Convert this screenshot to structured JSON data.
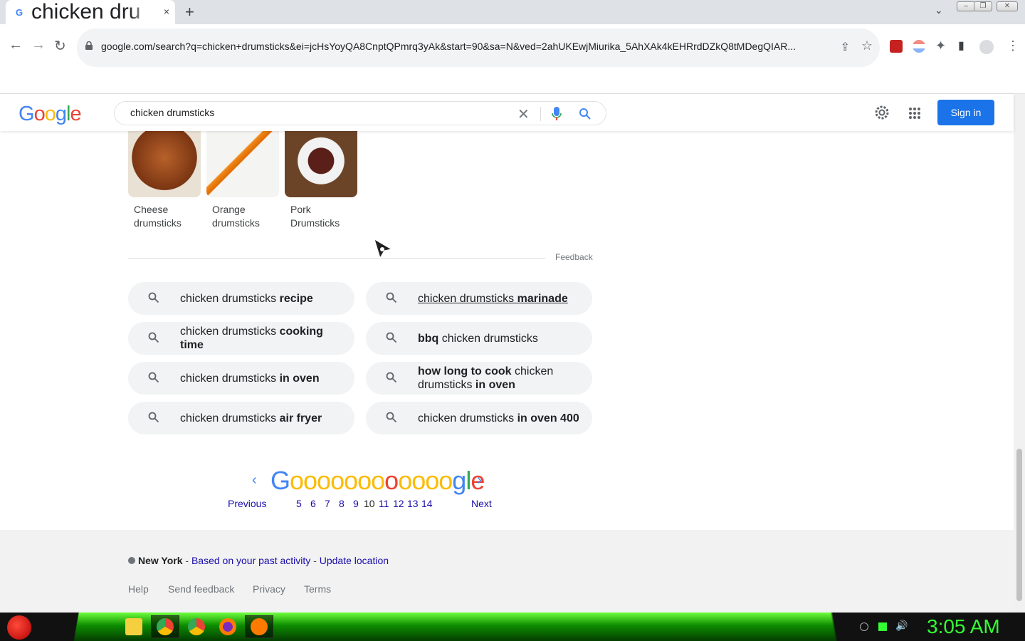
{
  "browser": {
    "tab_title": "chicken dru",
    "tab_favicon": "G",
    "close_tab": "×",
    "new_tab": "+",
    "url": "google.com/search?q=chicken+drumsticks&ei=jcHsYoyQA8CnptQPmrq3yAk&start=90&sa=N&ved=2ahUKEwjMiurika_5AhXAk4kEHRrdDZkQ8tMDegQIAR...",
    "icons": [
      "back-icon",
      "forward-icon",
      "reload-icon",
      "lock-icon",
      "share-icon",
      "star-icon",
      "extension-icon",
      "profile-icon",
      "menu-icon"
    ]
  },
  "header": {
    "logo": "Google",
    "search_query": "chicken drumsticks",
    "sign_in": "Sign in"
  },
  "related_images": [
    {
      "label": "Cheese drumsticks"
    },
    {
      "label": "Orange drumsticks"
    },
    {
      "label": "Pork Drumsticks"
    }
  ],
  "feedback": "Feedback",
  "related_searches": [
    {
      "pre": "chicken drumsticks ",
      "bold": "recipe",
      "post": ""
    },
    {
      "pre": "chicken drumsticks ",
      "bold": "marinade",
      "post": ""
    },
    {
      "pre": "chicken drumsticks ",
      "bold": "cooking time",
      "post": ""
    },
    {
      "pre": "",
      "bold": "bbq",
      "post": " chicken drumsticks"
    },
    {
      "pre": "chicken drumsticks ",
      "bold": "in oven",
      "post": ""
    },
    {
      "pre": "",
      "bold": "how long to cook",
      "post": " chicken drumsticks ",
      "bold2": "in oven"
    },
    {
      "pre": "chicken drumsticks ",
      "bold": "air fryer",
      "post": ""
    },
    {
      "pre": "chicken drumsticks ",
      "bold": "in oven 400",
      "post": ""
    }
  ],
  "pagination": {
    "previous": "Previous",
    "next": "Next",
    "pages": [
      "5",
      "6",
      "7",
      "8",
      "9",
      "10",
      "11",
      "12",
      "13",
      "14"
    ],
    "current": "10",
    "prev_arrow": "‹",
    "next_arrow": "›"
  },
  "footer": {
    "location": "New York",
    "sep1": " - ",
    "based_on": "Based on your past activity",
    "sep2": " - ",
    "update_location": "Update location",
    "links": [
      "Help",
      "Send feedback",
      "Privacy",
      "Terms"
    ]
  },
  "taskbar": {
    "clock": "3:05 AM"
  }
}
